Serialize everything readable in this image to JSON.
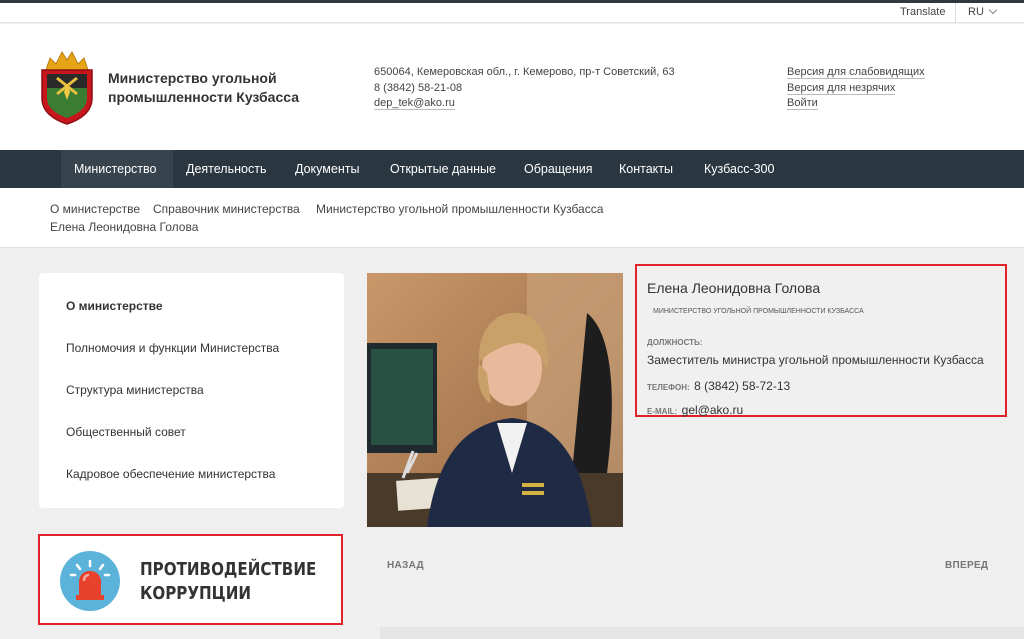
{
  "topbar": {
    "translate": "Translate",
    "lang": "RU"
  },
  "header": {
    "title": "Министерство угольной промышленности Кузбасса",
    "address": "650064, Кемеровская обл., г. Кемерово, пр-т Советский, 63",
    "phone": "8 (3842) 58-21-08",
    "email": "dep_tek@ako.ru",
    "links": [
      "Версия для слабовидящих",
      "Версия для незрячих",
      "Войти"
    ]
  },
  "nav": [
    "Министерство",
    "Деятельность",
    "Документы",
    "Открытые данные",
    "Обращения",
    "Контакты",
    "Кузбасс-300"
  ],
  "breadcrumbs": [
    "О министерстве",
    "Справочник министерства",
    "Министерство угольной промышленности Кузбасса",
    "Елена Леонидовна Голова"
  ],
  "sidebar": [
    "О министерстве",
    "Полномочия и функции Министерства",
    "Структура министерства",
    "Общественный совет",
    "Кадровое обеспечение министерства"
  ],
  "banner": {
    "line1": "ПРОТИВОДЕЙСТВИЕ",
    "line2": "КОРРУПЦИИ"
  },
  "person": {
    "name": "Елена Леонидовна Голова",
    "org": "Министерство угольной промышленности Кузбасса",
    "position_label": "Должность:",
    "position": "Заместитель министра угольной промышленности Кузбасса",
    "phone_label": "Телефон:",
    "phone": "8 (3842) 58-72-13",
    "email_label": "E-mail:",
    "email": "gel@ako.ru"
  },
  "pager": {
    "back": "НАЗАД",
    "forward": "ВПЕРЕД"
  },
  "colors": {
    "nav_bg": "#2b3740",
    "highlight_border": "#e0222a",
    "banner_circle": "#5cb3d9"
  }
}
